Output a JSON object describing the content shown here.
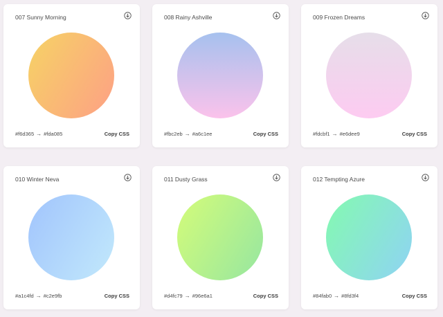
{
  "cards": [
    {
      "title": "007 Sunny Morning",
      "from": "#f6d365",
      "to": "#fda085",
      "arrow": "→",
      "copy_label": "Copy CSS",
      "color_from": "#f6d365",
      "color_to": "#fda085"
    },
    {
      "title": "008 Rainy Ashville",
      "from": "#fbc2eb",
      "to": "#a6c1ee",
      "arrow": "→",
      "copy_label": "Copy CSS",
      "color_from": "#a6c1ee",
      "color_to": "#fbc2eb"
    },
    {
      "title": "009 Frozen Dreams",
      "from": "#fdcbf1",
      "to": "#e6dee9",
      "arrow": "→",
      "copy_label": "Copy CSS",
      "color_from": "#e6dee9",
      "color_to": "#fdcbf1"
    },
    {
      "title": "010 Winter Neva",
      "from": "#a1c4fd",
      "to": "#c2e9fb",
      "arrow": "→",
      "copy_label": "Copy CSS",
      "color_from": "#a1c4fd",
      "color_to": "#c2e9fb"
    },
    {
      "title": "011 Dusty Grass",
      "from": "#d4fc79",
      "to": "#96e6a1",
      "arrow": "→",
      "copy_label": "Copy CSS",
      "color_from": "#d4fc79",
      "color_to": "#96e6a1"
    },
    {
      "title": "012 Tempting Azure",
      "from": "#84fab0",
      "to": "#8fd3f4",
      "arrow": "→",
      "copy_label": "Copy CSS",
      "color_from": "#84fab0",
      "color_to": "#8fd3f4"
    }
  ],
  "icons": {
    "download": "download-circle-icon"
  }
}
